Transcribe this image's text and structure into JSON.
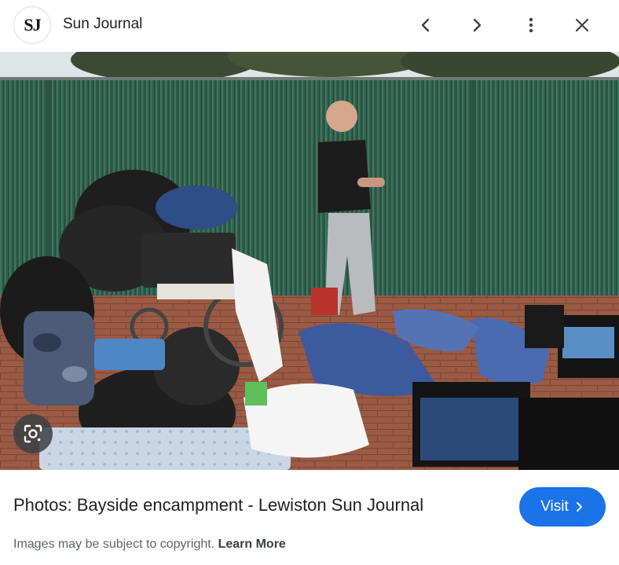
{
  "header": {
    "logo_text": "SJ",
    "source_name": "Sun Journal",
    "icons": [
      "chevron-left-icon",
      "chevron-right-icon",
      "more-vert-icon",
      "close-icon"
    ]
  },
  "image": {
    "lens_icon": "google-lens-icon"
  },
  "caption": {
    "title": "Photos: Bayside encampment - Lewiston Sun Journal",
    "visit_label": "Visit",
    "visit_icon": "chevron-right-icon"
  },
  "footer": {
    "copyright_text": "Images may be subject to copyright.",
    "learn_more_label": "Learn More"
  },
  "colors": {
    "accent": "#1a73e8",
    "text": "#202124",
    "muted": "#5f6368"
  }
}
